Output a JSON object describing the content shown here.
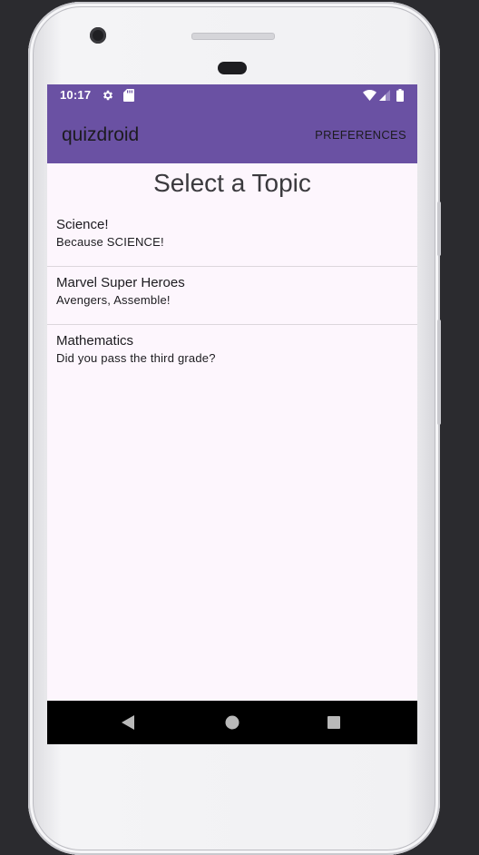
{
  "status_bar": {
    "time": "10:17",
    "icons": [
      "settings-icon",
      "sd-card-icon",
      "wifi-icon",
      "cell-signal-icon",
      "battery-icon"
    ]
  },
  "app_bar": {
    "title": "quizdroid",
    "action_label": "PREFERENCES"
  },
  "main": {
    "title": "Select a Topic",
    "topics": [
      {
        "name": "Science!",
        "description": "Because SCIENCE!"
      },
      {
        "name": "Marvel Super Heroes",
        "description": "Avengers, Assemble!"
      },
      {
        "name": "Mathematics",
        "description": "Did you pass the third grade?"
      }
    ]
  },
  "nav_bar": {
    "buttons": [
      "back-icon",
      "home-icon",
      "recents-icon"
    ]
  },
  "colors": {
    "primary": "#6a51a3",
    "background": "#fdf6fd",
    "text": "#1c1b1f"
  }
}
